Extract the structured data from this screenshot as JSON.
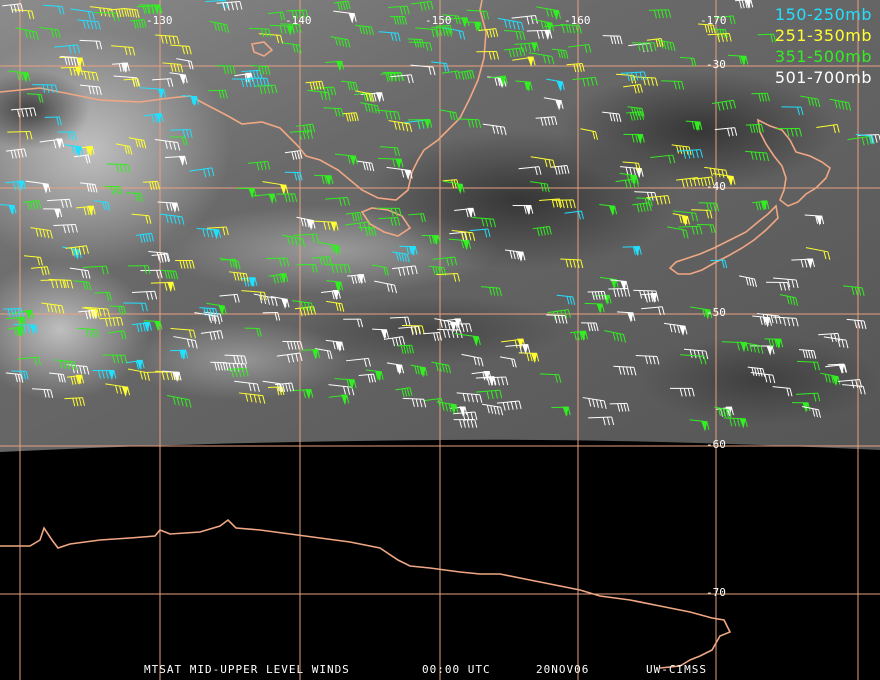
{
  "longitude_labels": [
    "-130",
    "-140",
    "-150",
    "-160",
    "-170"
  ],
  "latitude_labels": [
    "-30",
    "-40",
    "-50",
    "-60",
    "-70"
  ],
  "legend": [
    {
      "label": "150-250mb",
      "color": "#22e0ff"
    },
    {
      "label": "251-350mb",
      "color": "#ffff33"
    },
    {
      "label": "351-500mb",
      "color": "#33ee22"
    },
    {
      "label": "501-700mb",
      "color": "#ffffff"
    }
  ],
  "footer": {
    "product": "MTSAT MID-UPPER LEVEL WINDS",
    "time": "00:00 UTC",
    "date": "20NOV06",
    "source": "UW-CIMSS"
  },
  "colors": {
    "background_night": "#000000",
    "coastline": "#f0a784",
    "grid": "#e8a080",
    "cloud_base": "#5a5a5a"
  }
}
